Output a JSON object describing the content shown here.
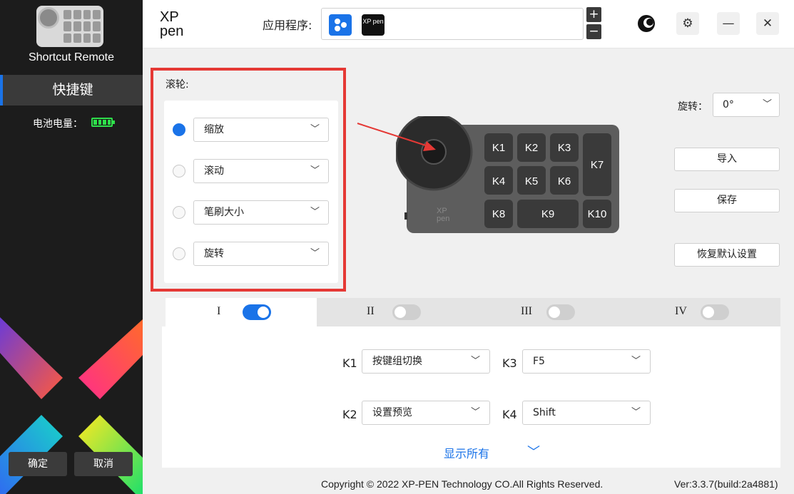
{
  "sidebar": {
    "device_name": "Shortcut Remote",
    "nav_item": "快捷键",
    "battery_label": "电池电量：",
    "confirm_label": "确定",
    "cancel_label": "取消"
  },
  "header": {
    "logo_text_top": "XP",
    "logo_text_bottom": "pen",
    "app_label": "应用程序:",
    "app_icons": [
      "global-app-icon",
      "xppen-app-icon"
    ],
    "xppen_icon_text": "XP pen",
    "plus": "+",
    "minus": "−",
    "settings_icon": "⚙",
    "minimize_icon": "—",
    "close_icon": "✕"
  },
  "wheel": {
    "title": "滚轮:",
    "options": [
      {
        "label": "缩放",
        "selected": true
      },
      {
        "label": "滚动",
        "selected": false
      },
      {
        "label": "笔刷大小",
        "selected": false
      },
      {
        "label": "旋转",
        "selected": false
      }
    ]
  },
  "device": {
    "keys": [
      "K1",
      "K2",
      "K3",
      "K4",
      "K5",
      "K6",
      "K7",
      "K8",
      "K9",
      "K10"
    ],
    "logo_top": "XP",
    "logo_bottom": "pen"
  },
  "right_panel": {
    "rotation_label": "旋转：",
    "rotation_value": "0°",
    "import_label": "导入",
    "save_label": "保存",
    "restore_label": "恢复默认设置"
  },
  "tabs": [
    {
      "label": "I",
      "enabled": true
    },
    {
      "label": "II",
      "enabled": false
    },
    {
      "label": "III",
      "enabled": false
    },
    {
      "label": "IV",
      "enabled": false
    }
  ],
  "key_settings": [
    {
      "key": "K1",
      "value": "按键组切换"
    },
    {
      "key": "K3",
      "value": "F5"
    },
    {
      "key": "K2",
      "value": "设置预览"
    },
    {
      "key": "K4",
      "value": "Shift"
    }
  ],
  "show_all": "显示所有",
  "footer": {
    "copyright": "Copyright © 2022  XP-PEN Technology CO.All Rights Reserved.",
    "version": "Ver:3.3.7(build:2a4881)"
  },
  "colors": {
    "accent": "#1a73e8",
    "highlight_frame": "#e53935",
    "sidebar_bg": "#1c1c1c"
  }
}
